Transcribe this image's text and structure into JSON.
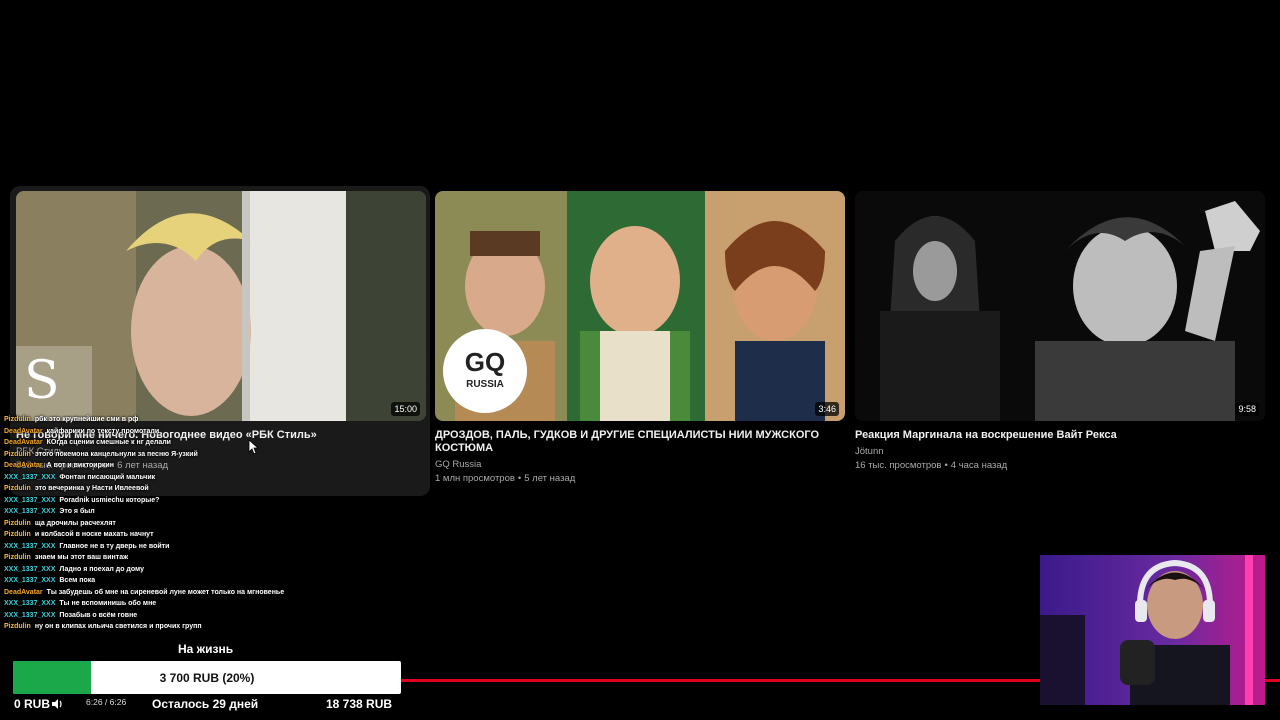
{
  "videos": [
    {
      "title": "Не говори мне ничего. Новогоднее видео «РБК Стиль»",
      "channel": "РБК Стиль",
      "views": "513 тыс. просмотров",
      "age": "6 лет назад",
      "duration": "15:00",
      "logo_text": "S"
    },
    {
      "title": "ДРОЗДОВ, ПАЛЬ, ГУДКОВ И ДРУГИЕ СПЕЦИАЛИСТЫ НИИ МУЖСКОГО КОСТЮМА",
      "channel": "GQ Russia",
      "views": "1 млн просмотров",
      "age": "5 лет назад",
      "duration": "3:46",
      "logo_top": "GQ",
      "logo_bottom": "RUSSIA"
    },
    {
      "title": "Реакция Маргинала на воскрешение Вайт Рекса",
      "channel": "Jötunn",
      "views": "16 тыс. просмотров",
      "age": "4 часа назад",
      "duration": "9:58"
    }
  ],
  "chat": [
    {
      "user": "Pizdulin",
      "text": "рбк это крупнейшие сми в рф",
      "color": "#f5b942"
    },
    {
      "user": "DeadAvatar",
      "text": "кайфарики по тексту промотали",
      "color": "#f5a623"
    },
    {
      "user": "DeadAvatar",
      "text": "КОгда сцении смешные к нг делали",
      "color": "#f5a623"
    },
    {
      "user": "Pizdulin",
      "text": "этого покемона канцельнули за песню Я-узкий",
      "color": "#f5b942"
    },
    {
      "user": "DeadAvatar",
      "text": "А вот и виктоиркин",
      "color": "#f5a623"
    },
    {
      "user": "XXX_1337_XXX",
      "text": "Фонтан писающий мальчик",
      "color": "#3ad0d8"
    },
    {
      "user": "Pizdulin",
      "text": "это вечеринка у Насти Ивлеевой",
      "color": "#f5b942"
    },
    {
      "user": "XXX_1337_XXX",
      "text": "Poradnik usmiechu которые?",
      "color": "#3ad0d8"
    },
    {
      "user": "XXX_1337_XXX",
      "text": "Это я был",
      "color": "#3ad0d8"
    },
    {
      "user": "Pizdulin",
      "text": "ща дрочилы расчехлят",
      "color": "#f5b942"
    },
    {
      "user": "Pizdulin",
      "text": "и колбасой в носке махать начнут",
      "color": "#f5b942"
    },
    {
      "user": "XXX_1337_XXX",
      "text": "Главное не в ту дверь не войти",
      "color": "#3ad0d8"
    },
    {
      "user": "Pizdulin",
      "text": "знаем мы этот ваш винтаж",
      "color": "#f5b942"
    },
    {
      "user": "XXX_1337_XXX",
      "text": "Ладно я поехал до дому",
      "color": "#3ad0d8"
    },
    {
      "user": "XXX_1337_XXX",
      "text": "Всем пока",
      "color": "#3ad0d8"
    },
    {
      "user": "DeadAvatar",
      "text": "Ты забудешь об мне на сиреневой луне может только на мгновенье",
      "color": "#f5a623"
    },
    {
      "user": "XXX_1337_XXX",
      "text": "Ты не вспоминишь обо мне",
      "color": "#3ad0d8"
    },
    {
      "user": "XXX_1337_XXX",
      "text": "Позабыв о всём говне",
      "color": "#3ad0d8"
    },
    {
      "user": "Pizdulin",
      "text": "ну он в клипах ильича светился и прочих групп",
      "color": "#f5b942"
    }
  ],
  "goal": {
    "title": "На жизнь",
    "amount": "3 700 RUB (20%)",
    "progress_percent": 20,
    "remaining": "Осталось 29 дней",
    "total": "18 738 RUB",
    "current": "0 RUB"
  },
  "player": {
    "time": "6:26 / 6:26"
  },
  "colors": {
    "accent_red": "#e0001a",
    "goal_green": "#1aa84a"
  }
}
